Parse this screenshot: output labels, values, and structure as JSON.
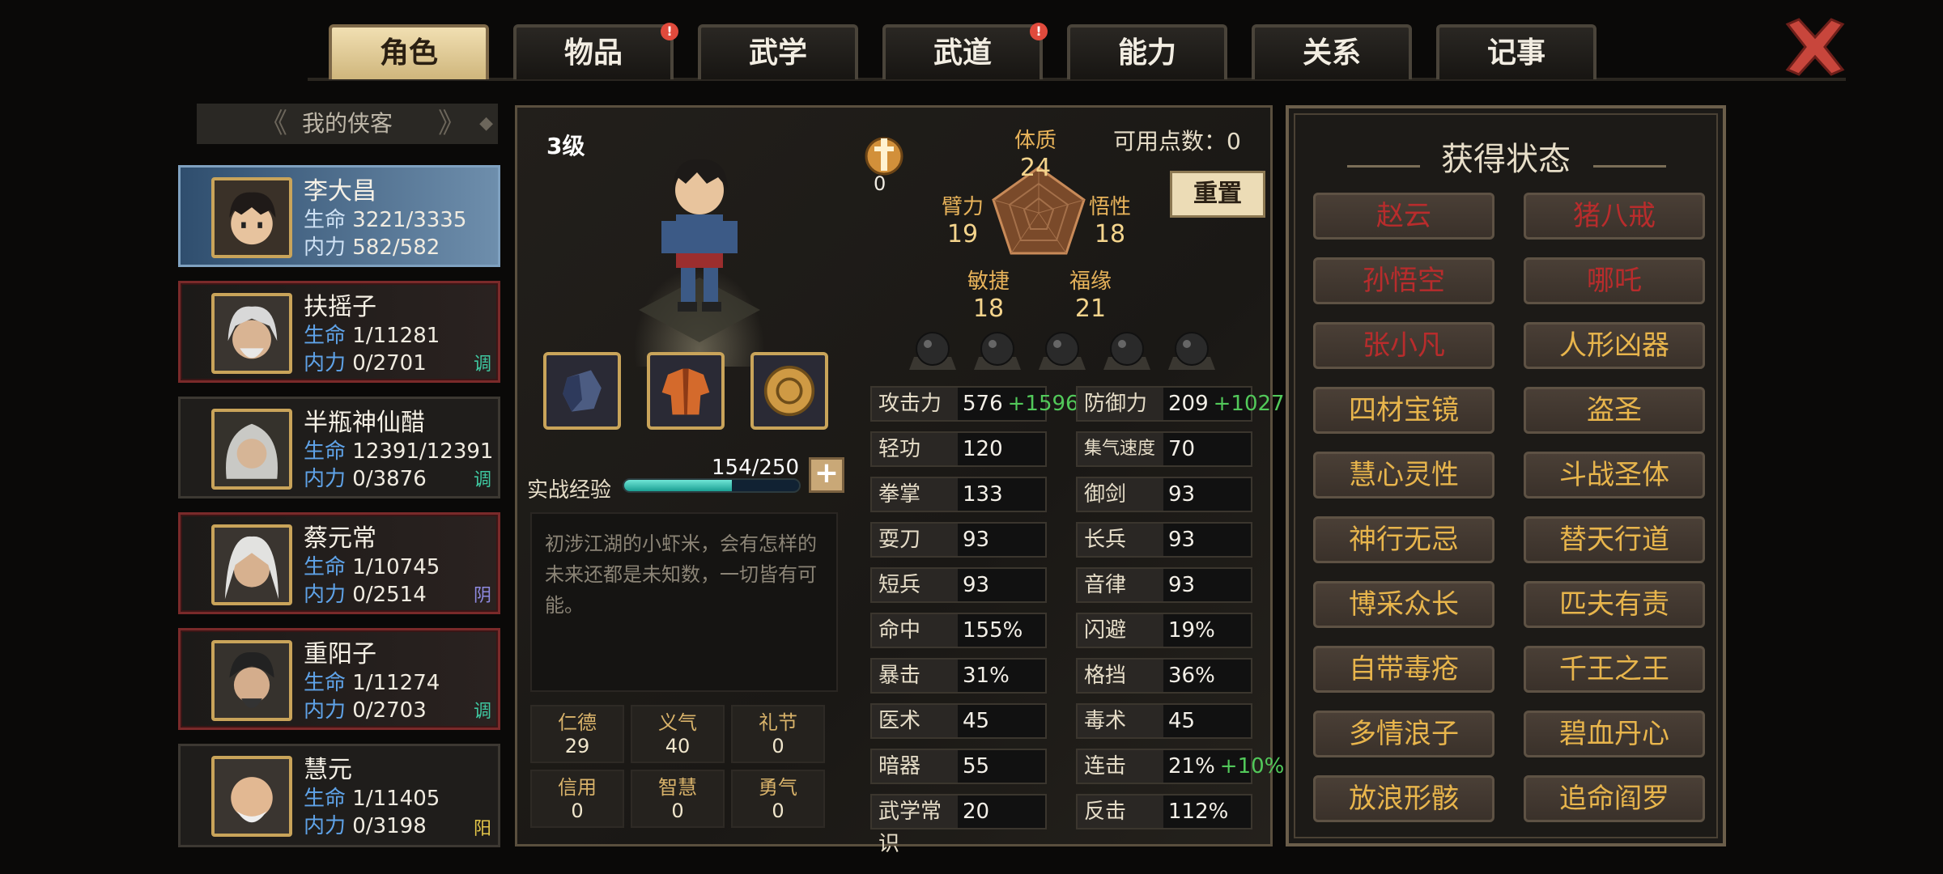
{
  "tabs": [
    {
      "label": "角色",
      "active": true,
      "alert": false
    },
    {
      "label": "物品",
      "active": false,
      "alert": true
    },
    {
      "label": "武学",
      "active": false,
      "alert": false
    },
    {
      "label": "武道",
      "active": false,
      "alert": true
    },
    {
      "label": "能力",
      "active": false,
      "alert": false
    },
    {
      "label": "关系",
      "active": false,
      "alert": false
    },
    {
      "label": "记事",
      "active": false,
      "alert": false
    }
  ],
  "alert_mark": "!",
  "roster": {
    "title": "我的侠客",
    "heroes": [
      {
        "name": "李大昌",
        "hp_label": "生命",
        "hp": "3221/3335",
        "mp_label": "内力",
        "mp": "582/582",
        "tag": "",
        "selected": true
      },
      {
        "name": "扶摇子",
        "hp_label": "生命",
        "hp": "1/11281",
        "mp_label": "内力",
        "mp": "0/2701",
        "tag": "调",
        "tag_color": "#3fc7a0"
      },
      {
        "name": "半瓶神仙醋",
        "hp_label": "生命",
        "hp": "12391/12391",
        "mp_label": "内力",
        "mp": "0/3876",
        "tag": "调",
        "tag_color": "#3fc7a0"
      },
      {
        "name": "蔡元常",
        "hp_label": "生命",
        "hp": "1/10745",
        "mp_label": "内力",
        "mp": "0/2514",
        "tag": "阴",
        "tag_color": "#8e8ae0"
      },
      {
        "name": "重阳子",
        "hp_label": "生命",
        "hp": "1/11274",
        "mp_label": "内力",
        "mp": "0/2703",
        "tag": "调",
        "tag_color": "#3fc7a0"
      },
      {
        "name": "慧元",
        "hp_label": "生命",
        "hp": "1/11405",
        "mp_label": "内力",
        "mp": "0/3198",
        "tag": "阳",
        "tag_color": "#e6c84a"
      }
    ]
  },
  "character": {
    "level": "3级",
    "medal_value": "0",
    "points_label": "可用点数：0",
    "reset_label": "重置",
    "exp_label": "实战经验",
    "exp_value": "154/250",
    "exp_fraction": 0.616,
    "plus": "+",
    "description": "初涉江湖的小虾米，会有怎样的未来还都是未知数，一切皆有可能。",
    "core_stats": {
      "tizhi": {
        "label": "体质",
        "value": "24"
      },
      "bili": {
        "label": "臂力",
        "value": "19"
      },
      "wuxing": {
        "label": "悟性",
        "value": "18"
      },
      "minjie": {
        "label": "敏捷",
        "value": "18"
      },
      "fuyuan": {
        "label": "福缘",
        "value": "21"
      }
    },
    "virtues": [
      {
        "label": "仁德",
        "value": "29"
      },
      {
        "label": "义气",
        "value": "40"
      },
      {
        "label": "礼节",
        "value": "0"
      },
      {
        "label": "信用",
        "value": "0"
      },
      {
        "label": "智慧",
        "value": "0"
      },
      {
        "label": "勇气",
        "value": "0"
      }
    ],
    "attributes_left": [
      {
        "k": "攻击力",
        "v": "576",
        "bonus": "+1596"
      },
      {
        "k": "轻功",
        "v": "120",
        "bonus": ""
      },
      {
        "k": "拳掌",
        "v": "133",
        "bonus": ""
      },
      {
        "k": "耍刀",
        "v": "93",
        "bonus": ""
      },
      {
        "k": "短兵",
        "v": "93",
        "bonus": ""
      },
      {
        "k": "命中",
        "v": "155%",
        "bonus": ""
      },
      {
        "k": "暴击",
        "v": "31%",
        "bonus": ""
      },
      {
        "k": "医术",
        "v": "45",
        "bonus": ""
      },
      {
        "k": "暗器",
        "v": "55",
        "bonus": ""
      },
      {
        "k": "武学常识",
        "v": "20",
        "bonus": ""
      }
    ],
    "attributes_right": [
      {
        "k": "防御力",
        "v": "209",
        "bonus": "+1027"
      },
      {
        "k": "集气速度",
        "v": "70",
        "bonus": ""
      },
      {
        "k": "御剑",
        "v": "93",
        "bonus": ""
      },
      {
        "k": "长兵",
        "v": "93",
        "bonus": ""
      },
      {
        "k": "音律",
        "v": "93",
        "bonus": ""
      },
      {
        "k": "闪避",
        "v": "19%",
        "bonus": ""
      },
      {
        "k": "格挡",
        "v": "36%",
        "bonus": ""
      },
      {
        "k": "毒术",
        "v": "45",
        "bonus": ""
      },
      {
        "k": "连击",
        "v": "21%",
        "bonus": "+10%"
      },
      {
        "k": "反击",
        "v": "112%",
        "bonus": ""
      }
    ]
  },
  "status": {
    "title": "获得状态",
    "items": [
      {
        "label": "赵云",
        "color": "red"
      },
      {
        "label": "猪八戒",
        "color": "red"
      },
      {
        "label": "孙悟空",
        "color": "red"
      },
      {
        "label": "哪吒",
        "color": "red"
      },
      {
        "label": "张小凡",
        "color": "red"
      },
      {
        "label": "人形凶器",
        "color": "gold"
      },
      {
        "label": "四材宝镜",
        "color": "gold"
      },
      {
        "label": "盗圣",
        "color": "gold"
      },
      {
        "label": "慧心灵性",
        "color": "gold"
      },
      {
        "label": "斗战圣体",
        "color": "gold"
      },
      {
        "label": "神行无忌",
        "color": "gold"
      },
      {
        "label": "替天行道",
        "color": "gold"
      },
      {
        "label": "博采众长",
        "color": "gold"
      },
      {
        "label": "匹夫有责",
        "color": "gold"
      },
      {
        "label": "自带毒疮",
        "color": "gold"
      },
      {
        "label": "千王之王",
        "color": "gold"
      },
      {
        "label": "多情浪子",
        "color": "gold"
      },
      {
        "label": "碧血丹心",
        "color": "gold"
      },
      {
        "label": "放浪形骸",
        "color": "gold"
      },
      {
        "label": "追命阎罗",
        "color": "gold"
      }
    ]
  }
}
